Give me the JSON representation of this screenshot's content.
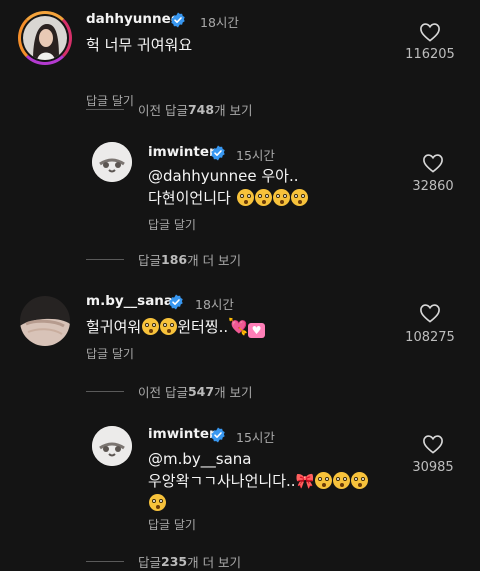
{
  "comments": [
    {
      "username": "dahhyunnee",
      "time": "18시간",
      "text": "헉 너무 귀여워요",
      "reply_label": "답글 달기",
      "likes": "116205"
    },
    {
      "username": "imwinter",
      "time": "15시간",
      "mention": "@dahhyunnee",
      "text_line1_rest": " 우아..",
      "text_line2": "다현이언니다",
      "reply_label": "답글 달기",
      "likes": "32860"
    },
    {
      "username": "m.by__sana",
      "time": "18시간",
      "text": "헐귀여워",
      "text_mid": "윈터찡..",
      "reply_label": "답글 달기",
      "likes": "108275"
    },
    {
      "username": "imwinter",
      "time": "15시간",
      "mention": "@m.by__sana",
      "text_line2": "우앙왁ㄱㄱ사나언니다..",
      "reply_label": "답글 달기",
      "likes": "30985"
    }
  ],
  "view_more": [
    {
      "prefix": "이전 답글 ",
      "count": "748",
      "suffix": "개 보기"
    },
    {
      "prefix": "답글 ",
      "count": "186",
      "suffix": "개 더 보기"
    },
    {
      "prefix": "이전 답글 ",
      "count": "547",
      "suffix": "개 보기"
    },
    {
      "prefix": "답글 ",
      "count": "235",
      "suffix": "개 더 보기"
    }
  ],
  "colors": {
    "background": "#141414",
    "verified_badge": "#3897f0",
    "story_ring": "#d6306a"
  },
  "icons": [
    "verified-badge-icon",
    "heart-outline-icon"
  ]
}
